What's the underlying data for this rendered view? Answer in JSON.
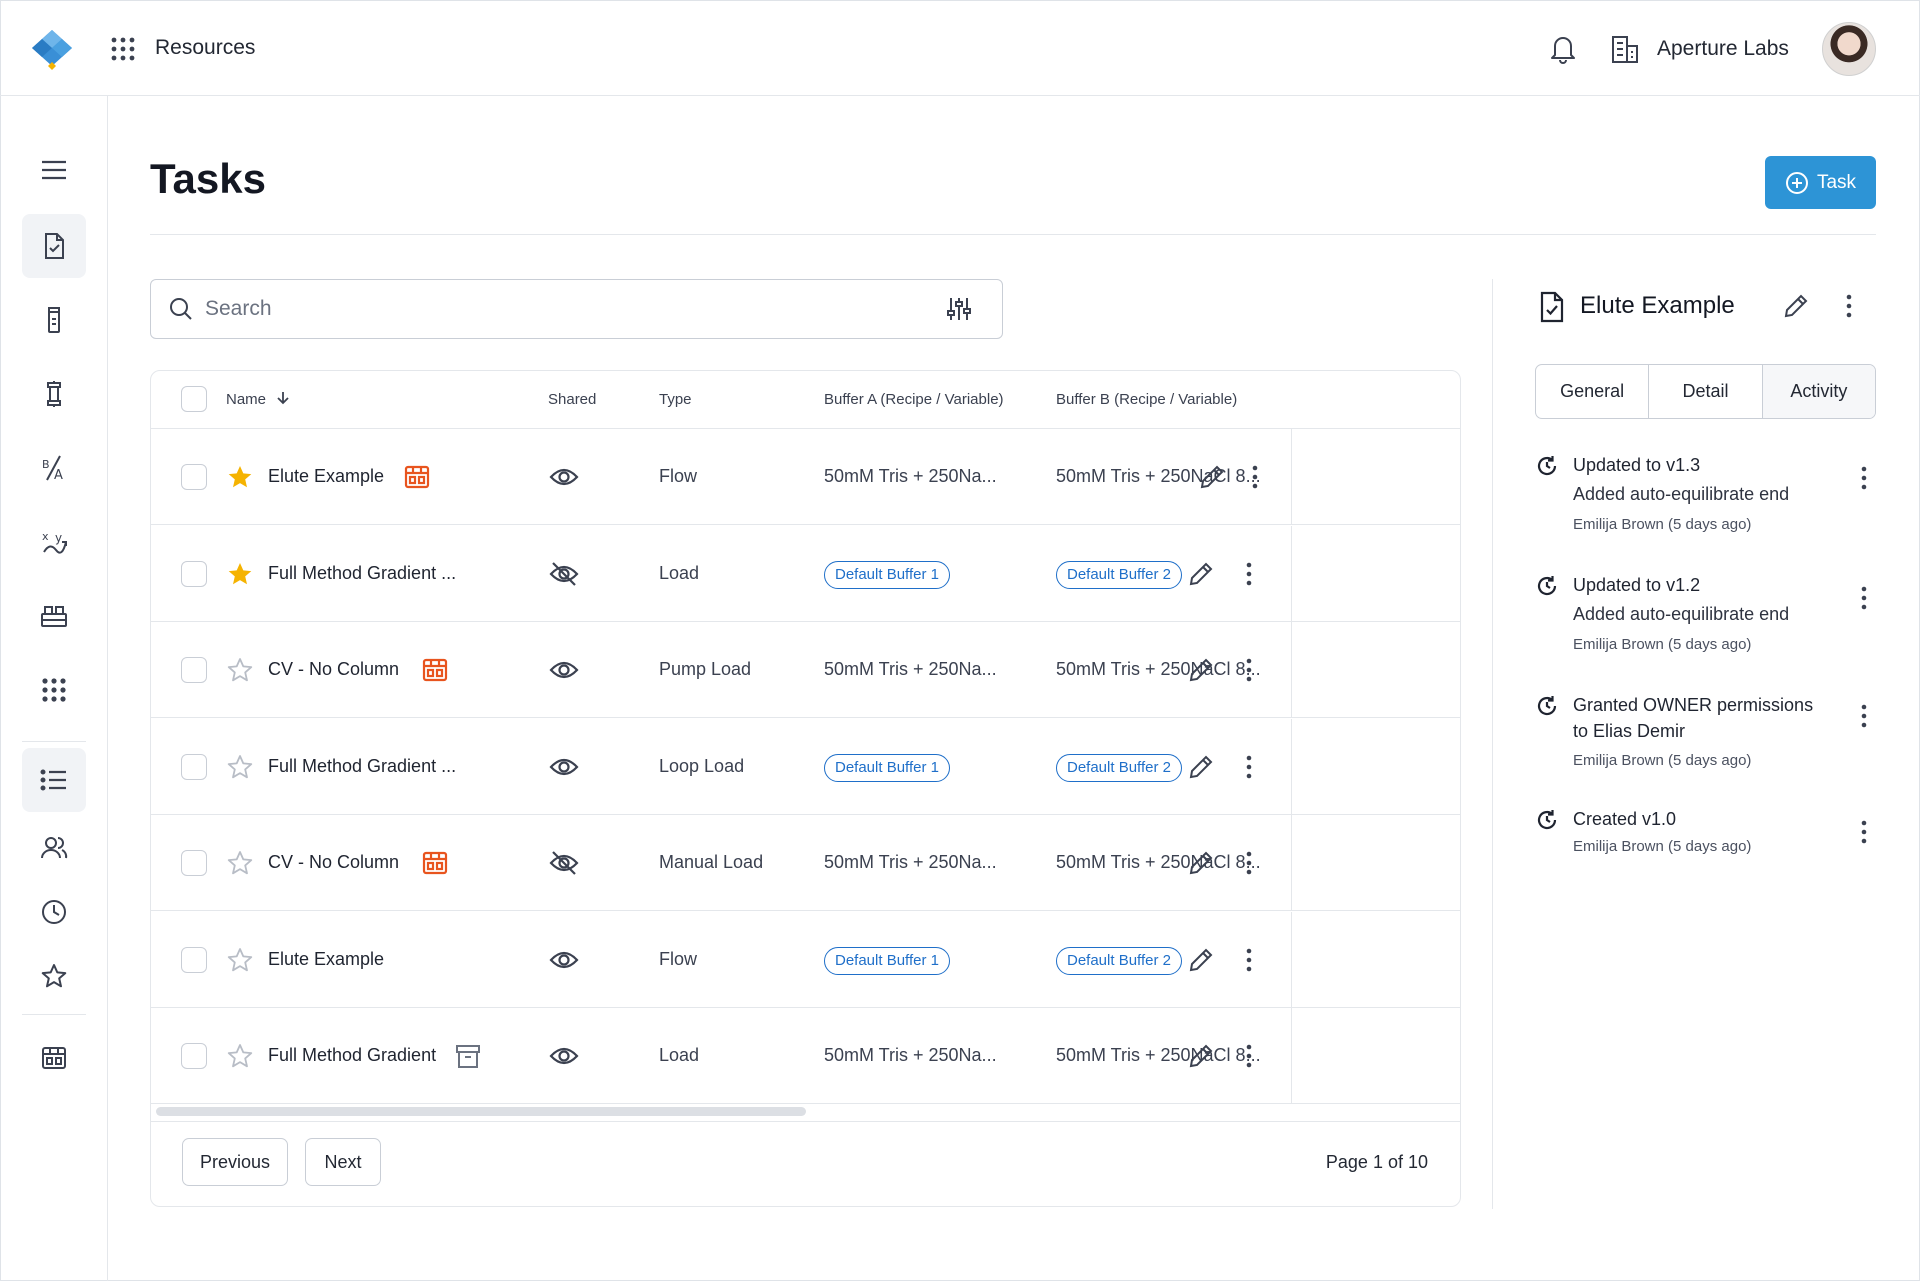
{
  "topbar": {
    "section_label": "Resources",
    "org_name": "Aperture Labs",
    "icons": [
      "logo-icon",
      "apps-grid-icon",
      "bell-icon",
      "building-icon",
      "avatar"
    ]
  },
  "sidebar": {
    "items": [
      "menu-icon",
      "task-doc-icon",
      "vial-icon",
      "column-icon",
      "buffer-formula-icon",
      "variables-icon",
      "equipment-icon",
      "apps-grid-icon",
      "list-icon",
      "users-icon",
      "history-icon",
      "star-icon",
      "store-icon"
    ]
  },
  "page": {
    "title": "Tasks",
    "add_button_label": "Task"
  },
  "search": {
    "placeholder": "Search"
  },
  "table": {
    "columns": {
      "name": "Name",
      "shared": "Shared",
      "type": "Type",
      "buffer_a": "Buffer A (Recipe / Variable)",
      "buffer_b": "Buffer B (Recipe / Variable)"
    },
    "rows": [
      {
        "starred": true,
        "name": "Elute Example",
        "tag": "store",
        "shared": true,
        "type": "Flow",
        "buffer_a": "50mM Tris + 250Na...",
        "buffer_a_chip": false,
        "buffer_b": "50mM Tris + 250NaCl 8...",
        "buffer_b_chip": false
      },
      {
        "starred": true,
        "name": "Full Method Gradient ...",
        "tag": "",
        "shared": false,
        "type": "Load",
        "buffer_a": "Default Buffer 1",
        "buffer_a_chip": true,
        "buffer_b": "Default Buffer 2",
        "buffer_b_chip": true
      },
      {
        "starred": false,
        "name": "CV -  No Column",
        "tag": "store",
        "shared": true,
        "type": "Pump  Load",
        "buffer_a": "50mM Tris + 250Na...",
        "buffer_a_chip": false,
        "buffer_b": "50mM Tris + 250NaCl 8...",
        "buffer_b_chip": false
      },
      {
        "starred": false,
        "name": "Full Method Gradient ...",
        "tag": "",
        "shared": true,
        "type": "Loop Load",
        "buffer_a": "Default Buffer 1",
        "buffer_a_chip": true,
        "buffer_b": "Default Buffer 2",
        "buffer_b_chip": true
      },
      {
        "starred": false,
        "name": "CV -  No Column",
        "tag": "store",
        "shared": false,
        "type": "Manual Load",
        "buffer_a": "50mM Tris + 250Na...",
        "buffer_a_chip": false,
        "buffer_b": "50mM Tris + 250NaCl 8...",
        "buffer_b_chip": false
      },
      {
        "starred": false,
        "name": "Elute Example",
        "tag": "",
        "shared": true,
        "type": "Flow",
        "buffer_a": "Default Buffer 1",
        "buffer_a_chip": true,
        "buffer_b": "Default Buffer 2",
        "buffer_b_chip": true
      },
      {
        "starred": false,
        "name": "Full Method Gradient",
        "tag": "archive",
        "shared": true,
        "type": "Load",
        "buffer_a": "50mM Tris + 250Na...",
        "buffer_a_chip": false,
        "buffer_b": "50mM Tris + 250NaCl 8...",
        "buffer_b_chip": false
      }
    ]
  },
  "pagination": {
    "previous_label": "Previous",
    "next_label": "Next",
    "page_info": "Page 1 of 10"
  },
  "panel": {
    "title": "Elute Example",
    "tabs": [
      "General",
      "Detail",
      "Activity"
    ],
    "active_tab": "Activity",
    "activities": [
      {
        "title": "Updated to v1.3",
        "description": "Added auto-equilibrate end",
        "meta": "Emilija Brown (5 days ago)"
      },
      {
        "title": "Updated to v1.2",
        "description": "Added auto-equilibrate end",
        "meta": "Emilija Brown (5 days ago)"
      },
      {
        "title": "Granted OWNER permissions to Elias Demir",
        "description": "",
        "meta": "Emilija Brown (5 days ago)"
      },
      {
        "title": "Created v1.0",
        "description": "",
        "meta": "Emilija Brown (5 days ago)"
      }
    ]
  },
  "colors": {
    "primary": "#2d94d6",
    "star_filled": "#f5b301",
    "store_tag": "#e8541e",
    "chip_blue": "#1f6fc9",
    "text": "#1f2430"
  }
}
